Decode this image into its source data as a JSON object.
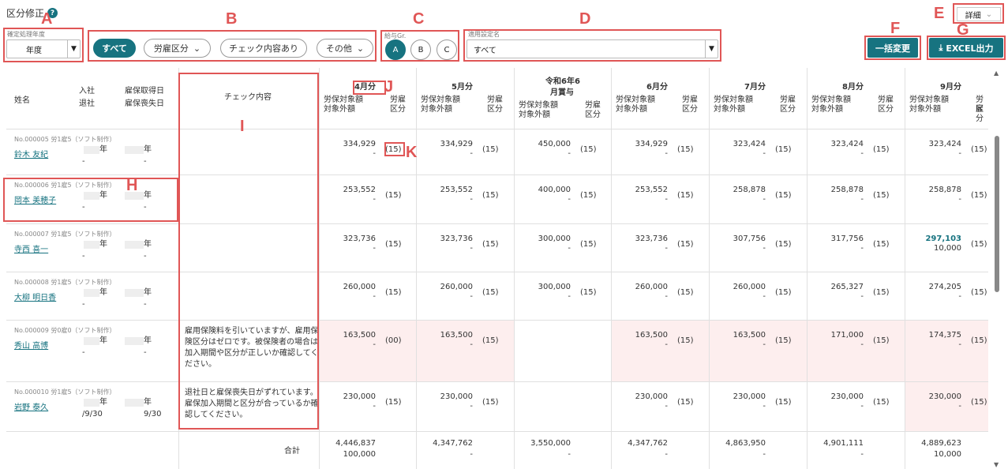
{
  "page_title": "区分修正",
  "help_icon": "question-icon",
  "fiscal": {
    "label": "確定処理年度",
    "value": "年度"
  },
  "filters": {
    "all": "すべて",
    "labor": "労雇区分",
    "checked": "チェック内容あり",
    "other": "その他"
  },
  "pay_group": {
    "label": "給与Gr.",
    "options": [
      "A",
      "B",
      "C"
    ]
  },
  "setting": {
    "label": "適用設定名",
    "value": "すべて"
  },
  "detail_label": "詳細",
  "bulk_label": "一括変更",
  "excel_label": "EXCEL出力",
  "markers": {
    "A": "A",
    "B": "B",
    "C": "C",
    "D": "D",
    "E": "E",
    "F": "F",
    "G": "G",
    "H": "H",
    "I": "I",
    "J": "J",
    "K": "K"
  },
  "header": {
    "name": "姓名",
    "join": "入社",
    "leave": "退社",
    "emp_get": "雇保取得日",
    "emp_loss": "雇保喪失日",
    "check": "チェック内容",
    "months": [
      {
        "title": "4月分",
        "pre": "",
        "l1": "労保対象額",
        "l2": "対象外額",
        "k": "労雇",
        "k2": "区分"
      },
      {
        "title": "5月分",
        "pre": "",
        "l1": "労保対象額",
        "l2": "対象外額",
        "k": "労雇",
        "k2": "区分"
      },
      {
        "title": "月賞与",
        "pre": "令和6年6",
        "l1": "労保対象額",
        "l2": "対象外額",
        "k": "労雇",
        "k2": "区分"
      },
      {
        "title": "6月分",
        "pre": "",
        "l1": "労保対象額",
        "l2": "対象外額",
        "k": "労雇",
        "k2": "区分"
      },
      {
        "title": "7月分",
        "pre": "",
        "l1": "労保対象額",
        "l2": "対象外額",
        "k": "労雇",
        "k2": "区分"
      },
      {
        "title": "8月分",
        "pre": "",
        "l1": "労保対象額",
        "l2": "対象外額",
        "k": "労雇",
        "k2": "区分"
      },
      {
        "title": "9月分",
        "pre": "",
        "l1": "労保対象額",
        "l2": "対象外額",
        "k": "労雇",
        "k2": "区分"
      }
    ]
  },
  "rows": [
    {
      "no": "No.000005 労1雇5（ソフト制作）",
      "name": "鈴木 友紀",
      "y1": "年",
      "y2": "年",
      "d1": "-",
      "d2": "-",
      "check": "",
      "cells": [
        [
          "334,929",
          "-",
          "(15)"
        ],
        [
          "334,929",
          "-",
          "(15)"
        ],
        [
          "450,000",
          "-",
          "(15)"
        ],
        [
          "334,929",
          "-",
          "(15)"
        ],
        [
          "323,424",
          "-",
          "(15)"
        ],
        [
          "323,424",
          "-",
          "(15)"
        ],
        [
          "323,424",
          "-",
          "(15)"
        ]
      ]
    },
    {
      "no": "No.000006 労1雇5（ソフト制作）",
      "name": "岡本 美穂子",
      "y1": "年",
      "y2": "年",
      "d1": "-",
      "d2": "-",
      "check": "",
      "cells": [
        [
          "253,552",
          "-",
          "(15)"
        ],
        [
          "253,552",
          "-",
          "(15)"
        ],
        [
          "400,000",
          "-",
          "(15)"
        ],
        [
          "253,552",
          "-",
          "(15)"
        ],
        [
          "258,878",
          "-",
          "(15)"
        ],
        [
          "258,878",
          "-",
          "(15)"
        ],
        [
          "258,878",
          "-",
          "(15)"
        ]
      ]
    },
    {
      "no": "No.000007 労1雇5（ソフト制作）",
      "name": "寺西 喜一",
      "y1": "年",
      "y2": "年",
      "d1": "-",
      "d2": "-",
      "check": "",
      "cells": [
        [
          "323,736",
          "-",
          "(15)"
        ],
        [
          "323,736",
          "-",
          "(15)"
        ],
        [
          "300,000",
          "-",
          "(15)"
        ],
        [
          "323,736",
          "-",
          "(15)"
        ],
        [
          "307,756",
          "-",
          "(15)"
        ],
        [
          "317,756",
          "-",
          "(15)"
        ],
        [
          "297,103",
          "10,000",
          "(15)"
        ]
      ]
    },
    {
      "no": "No.000008 労1雇5（ソフト制作）",
      "name": "大柳 明日香",
      "y1": "年",
      "y2": "年",
      "d1": "-",
      "d2": "-",
      "check": "",
      "cells": [
        [
          "260,000",
          "-",
          "(15)"
        ],
        [
          "260,000",
          "-",
          "(15)"
        ],
        [
          "300,000",
          "-",
          "(15)"
        ],
        [
          "260,000",
          "-",
          "(15)"
        ],
        [
          "260,000",
          "-",
          "(15)"
        ],
        [
          "265,327",
          "-",
          "(15)"
        ],
        [
          "274,205",
          "-",
          "(15)"
        ]
      ]
    },
    {
      "no": "No.000009 労0雇0（ソフト制作）",
      "name": "秀山 高博",
      "y1": "年",
      "y2": "年",
      "d1": "-",
      "d2": "-",
      "check": "雇用保険料を引いていますが、雇用保険区分はゼロです。被保険者の場合は加入期間や区分が正しいか確認してください。",
      "cells": [
        [
          "163,500",
          "-",
          "(00)"
        ],
        [
          "163,500",
          "-",
          "(15)"
        ],
        [
          "",
          "",
          ""
        ],
        [
          "163,500",
          "-",
          "(15)"
        ],
        [
          "163,500",
          "-",
          "(15)"
        ],
        [
          "171,000",
          "-",
          "(15)"
        ],
        [
          "174,375",
          "-",
          "(15)"
        ]
      ]
    },
    {
      "no": "No.000010 労1雇5（ソフト制作）",
      "name": "岩野 泰久",
      "y1": "年",
      "y2": "年",
      "d1": "/9/30",
      "d2": "9/30",
      "check": "退社日と雇保喪失日がずれています。雇保加入期間と区分が合っているか確認してください。",
      "cells": [
        [
          "230,000",
          "-",
          "(15)"
        ],
        [
          "230,000",
          "-",
          "(15)"
        ],
        [
          "",
          "",
          ""
        ],
        [
          "230,000",
          "-",
          "(15)"
        ],
        [
          "230,000",
          "-",
          "(15)"
        ],
        [
          "230,000",
          "-",
          "(15)"
        ],
        [
          "230,000",
          "-",
          "(15)"
        ]
      ]
    }
  ],
  "totals": {
    "label": "合計",
    "values": [
      [
        "4,446,837",
        "100,000"
      ],
      [
        "4,347,762",
        "-"
      ],
      [
        "3,550,000",
        "-"
      ],
      [
        "4,347,762",
        "-"
      ],
      [
        "4,863,950",
        "-"
      ],
      [
        "4,901,111",
        "-"
      ],
      [
        "4,889,623",
        "10,000"
      ]
    ]
  }
}
